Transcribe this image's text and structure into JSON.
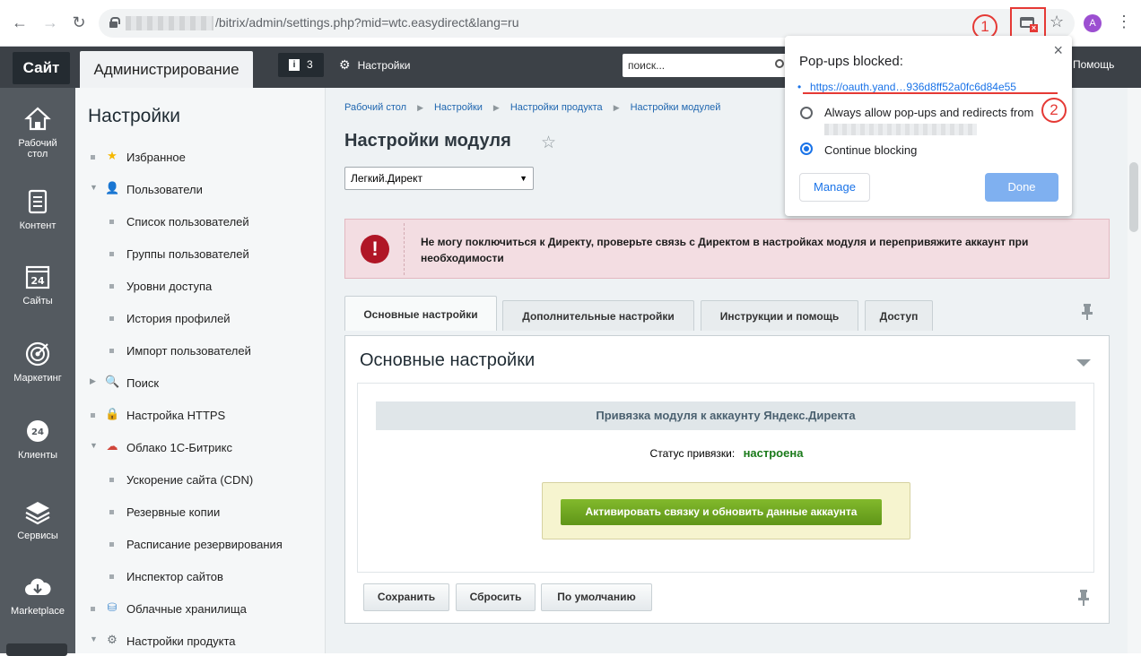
{
  "browser": {
    "url": "/bitrix/admin/settings.php?mid=wtc.easydirect&lang=ru",
    "avatar_letter": "A",
    "popup_bubble": {
      "title": "Pop-ups blocked:",
      "link": "https://oauth.yand…936d8ff52a0fc6d84e55",
      "option_allow": "Always allow pop-ups and redirects from",
      "option_block": "Continue blocking",
      "manage_label": "Manage",
      "done_label": "Done",
      "selected": "continue-blocking"
    },
    "markers": [
      "1",
      "2"
    ]
  },
  "topbar": {
    "site_label": "Сайт",
    "admin_label": "Администрирование",
    "notifications_count": "3",
    "settings_label": "Настройки",
    "search_placeholder": "поиск...",
    "help_label": "Помощь"
  },
  "iconbar": {
    "items": [
      {
        "label_line1": "Рабочий",
        "label_line2": "стол",
        "icon": "home-icon"
      },
      {
        "label_line1": "Контент",
        "label_line2": "",
        "icon": "document-icon"
      },
      {
        "label_line1": "Сайты",
        "label_line2": "",
        "icon": "calendar-24-icon"
      },
      {
        "label_line1": "Маркетинг",
        "label_line2": "",
        "icon": "target-icon"
      },
      {
        "label_line1": "Клиенты",
        "label_line2": "",
        "icon": "clock-24-icon"
      },
      {
        "label_line1": "Сервисы",
        "label_line2": "",
        "icon": "layers-icon"
      },
      {
        "label_line1": "Marketplace",
        "label_line2": "",
        "icon": "cloud-download-icon"
      }
    ]
  },
  "menu": {
    "title": "Настройки",
    "items": [
      {
        "label": "Избранное",
        "level": 0,
        "marker": "bullet",
        "icon": "star-icon"
      },
      {
        "label": "Пользователи",
        "level": 0,
        "marker": "expanded",
        "icon": "user-icon"
      },
      {
        "label": "Список пользователей",
        "level": 1,
        "marker": "bullet"
      },
      {
        "label": "Группы пользователей",
        "level": 1,
        "marker": "bullet"
      },
      {
        "label": "Уровни доступа",
        "level": 1,
        "marker": "bullet"
      },
      {
        "label": "История профилей",
        "level": 1,
        "marker": "bullet"
      },
      {
        "label": "Импорт пользователей",
        "level": 1,
        "marker": "bullet"
      },
      {
        "label": "Поиск",
        "level": 0,
        "marker": "collapsed",
        "icon": "search-icon"
      },
      {
        "label": "Настройка HTTPS",
        "level": 0,
        "marker": "bullet",
        "icon": "lock-icon"
      },
      {
        "label": "Облако 1С-Битрикс",
        "level": 0,
        "marker": "expanded",
        "icon": "cloud-icon"
      },
      {
        "label": "Ускорение сайта (CDN)",
        "level": 1,
        "marker": "bullet"
      },
      {
        "label": "Резервные копии",
        "level": 1,
        "marker": "bullet"
      },
      {
        "label": "Расписание резервирования",
        "level": 1,
        "marker": "bullet"
      },
      {
        "label": "Инспектор сайтов",
        "level": 1,
        "marker": "bullet"
      },
      {
        "label": "Облачные хранилища",
        "level": 0,
        "marker": "bullet",
        "icon": "storage-icon"
      },
      {
        "label": "Настройки продукта",
        "level": 0,
        "marker": "expanded",
        "icon": "gear-icon"
      }
    ]
  },
  "main": {
    "breadcrumb": [
      "Рабочий стол",
      "Настройки",
      "Настройки продукта",
      "Настройки модулей"
    ],
    "page_title": "Настройки модуля",
    "module_select": "Легкий.Директ",
    "error_text": "Не могу поключиться к Директу, проверьте связь с Директом в настройках модуля и перепривяжите аккаунт при необходимости",
    "tabs": [
      "Основные настройки",
      "Дополнительные настройки",
      "Инструкции и помощь",
      "Доступ"
    ],
    "active_tab": 0,
    "section_title": "Основные настройки",
    "binding_header": "Привязка модуля к аккаунту Яндекс.Директа",
    "status_label": "Статус привязки:",
    "status_value": "настроена",
    "activate_label": "Активировать связку и обновить данные аккаунта",
    "footer_buttons": [
      "Сохранить",
      "Сбросить",
      "По умолчанию"
    ]
  },
  "colors": {
    "status_ok": "#1a7a1a",
    "error_bg": "#f3dde2",
    "error_icon": "#b01626",
    "activate_btn": "#6ea31d",
    "marker_red": "#e53935",
    "link_blue": "#1a73e8"
  }
}
